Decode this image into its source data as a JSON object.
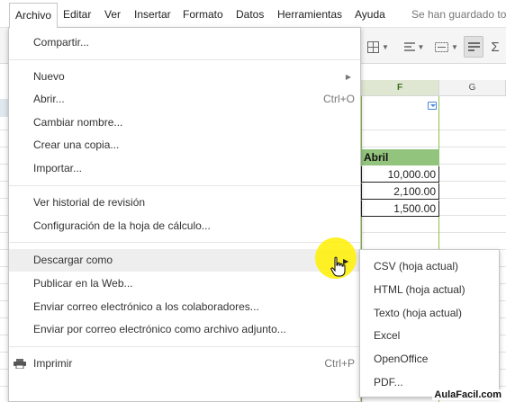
{
  "menubar": {
    "items": [
      "Archivo",
      "Editar",
      "Ver",
      "Insertar",
      "Formato",
      "Datos",
      "Herramientas",
      "Ayuda"
    ],
    "save_status": "Se han guardado to"
  },
  "toolbar": {
    "icons": [
      "borders-icon",
      "align-left-icon",
      "merge-cells-icon",
      "wrap-text-icon",
      "sum-icon"
    ]
  },
  "sheet": {
    "columns": [
      "F",
      "G"
    ],
    "selected_column": "F",
    "header_cell": "Abril",
    "values": [
      "10,000.00",
      "2,100.00",
      "1,500.00"
    ],
    "header_color": "#93c47d"
  },
  "file_menu": {
    "items": [
      {
        "label": "Compartir...",
        "shortcut": ""
      },
      {
        "label": "Nuevo",
        "shortcut": ""
      },
      {
        "label": "Abrir...",
        "shortcut": "Ctrl+O"
      },
      {
        "label": "Cambiar nombre...",
        "shortcut": ""
      },
      {
        "label": "Crear una copia...",
        "shortcut": ""
      },
      {
        "label": "Importar...",
        "shortcut": ""
      },
      {
        "label": "Ver historial de revisión",
        "shortcut": ""
      },
      {
        "label": "Configuración de la hoja de cálculo...",
        "shortcut": ""
      },
      {
        "label": "Descargar como",
        "shortcut": ""
      },
      {
        "label": "Publicar en la Web...",
        "shortcut": ""
      },
      {
        "label": "Enviar correo electrónico a los colaboradores...",
        "shortcut": ""
      },
      {
        "label": "Enviar por correo electrónico como archivo adjunto...",
        "shortcut": ""
      },
      {
        "label": "Imprimir",
        "shortcut": "Ctrl+P"
      }
    ]
  },
  "download_submenu": {
    "items": [
      "CSV (hoja actual)",
      "HTML (hoja actual)",
      "Texto (hoja actual)",
      "Excel",
      "OpenOffice",
      "PDF..."
    ]
  },
  "watermark": "AulaFacil.com"
}
